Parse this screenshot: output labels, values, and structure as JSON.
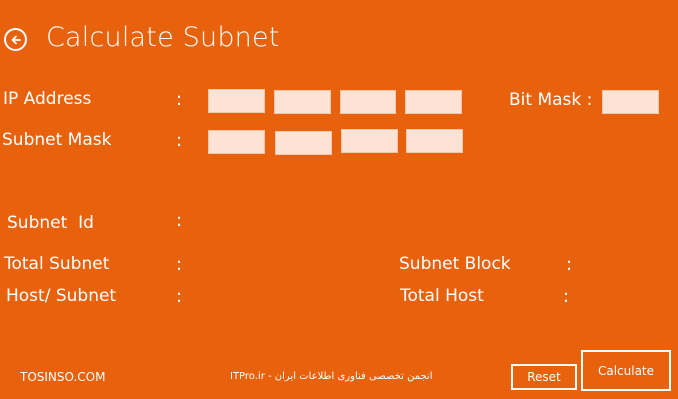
{
  "app": {
    "title": "Calculate Subnet"
  },
  "labels": {
    "ip_address": "IP Address",
    "subnet_mask": "Subnet Mask",
    "bit_mask": "Bit Mask :",
    "subnet_id": "Subnet  Id",
    "total_subnet": "Total Subnet",
    "host_subnet": "Host/ Subnet",
    "subnet_block": "Subnet Block",
    "total_host": "Total Host",
    "colon": ":"
  },
  "inputs": {
    "ip_octets": [
      "",
      "",
      "",
      ""
    ],
    "mask_octets": [
      "",
      "",
      "",
      ""
    ],
    "bit_mask": ""
  },
  "buttons": {
    "reset": "Reset",
    "calculate": "Calculate"
  },
  "footer": {
    "brand": "TOSINSO.COM",
    "caption": "ITPro.ir - انجمن تخصصی فناوری اطلاعات ایران"
  },
  "colors": {
    "background": "#e8620e",
    "input": "#fce3d3",
    "text": "#ffffff"
  },
  "icons": {
    "back": "back-arrow-icon"
  }
}
